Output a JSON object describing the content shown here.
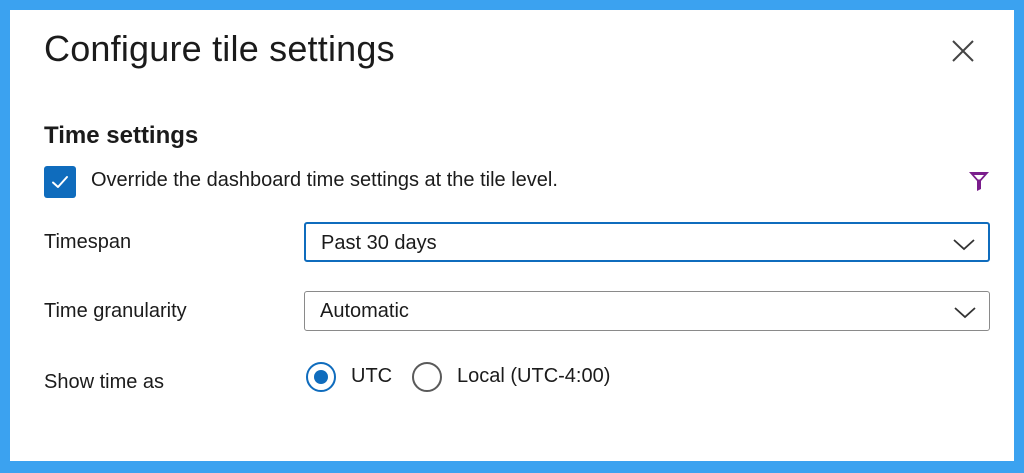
{
  "dialog": {
    "title": "Configure tile settings",
    "close_icon": "close-icon"
  },
  "time_settings": {
    "heading": "Time settings",
    "override_checkbox": {
      "label": "Override the dashboard time settings at the tile level.",
      "checked": true
    },
    "filter_icon": "filter-icon",
    "timespan": {
      "label": "Timespan",
      "value": "Past 30 days"
    },
    "granularity": {
      "label": "Time granularity",
      "value": "Automatic"
    },
    "show_time_as": {
      "label": "Show time as",
      "options": [
        {
          "label": "UTC",
          "selected": true
        },
        {
          "label": "Local (UTC-4:00)",
          "selected": false
        }
      ]
    }
  },
  "colors": {
    "accent": "#0f6cbd",
    "frame": "#3ba2f0",
    "filter_icon": "#7a1d8c"
  }
}
